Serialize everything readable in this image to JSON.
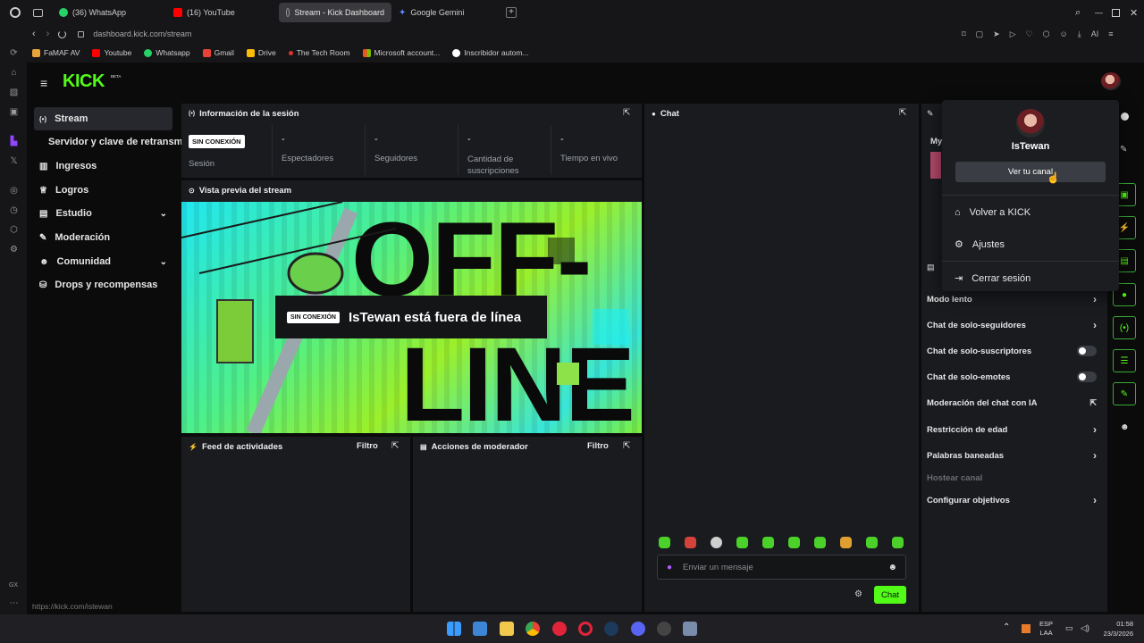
{
  "browser": {
    "tabs": [
      {
        "label": "(36) WhatsApp",
        "color": "#25d366"
      },
      {
        "label": "(16) YouTube",
        "color": "#ff0000"
      },
      {
        "label": "Stream - Kick Dashboard",
        "color": "#888888"
      },
      {
        "label": "Google Gemini",
        "color": "#5b8cff"
      }
    ],
    "url": "dashboard.kick.com/stream",
    "url_host_bold": "kick.com",
    "toolbar_ai": "AI",
    "status_url": "https://kick.com/istewan",
    "bookmarks": [
      {
        "label": "FaMAF AV",
        "color": "#e8a33a"
      },
      {
        "label": "Youtube",
        "color": "#ff0000"
      },
      {
        "label": "Whatsapp",
        "color": "#25d366"
      },
      {
        "label": "Gmail",
        "color": "#ea4335"
      },
      {
        "label": "Drive",
        "color": "#fbbc04"
      },
      {
        "label": "The Tech Room",
        "color": "#d33"
      },
      {
        "label": "Microsoft account...",
        "color": "#f25022"
      },
      {
        "label": "Inscribidor autom...",
        "color": "#ffffff"
      }
    ],
    "gx_label": "GX"
  },
  "kick": {
    "logo": "KICK",
    "logo_badge": "BETA",
    "accent": "#53fc18",
    "sidebar": [
      {
        "label": "Stream",
        "icon": "broadcast-icon",
        "active": true
      },
      {
        "label": "Servidor y clave de retransmisión",
        "icon": "",
        "active": false
      },
      {
        "label": "Ingresos",
        "icon": "chart-icon",
        "active": false
      },
      {
        "label": "Logros",
        "icon": "trophy-icon",
        "active": false
      },
      {
        "label": "Estudio",
        "icon": "studio-icon",
        "active": false,
        "expandable": true
      },
      {
        "label": "Moderación",
        "icon": "wrench-icon",
        "active": false
      },
      {
        "label": "Comunidad",
        "icon": "community-icon",
        "active": false,
        "expandable": true
      },
      {
        "label": "Drops y recompensas",
        "icon": "drops-icon",
        "active": false
      }
    ],
    "session": {
      "title": "Información de la sesión",
      "badge": "SIN CONEXIÓN",
      "stats": [
        {
          "value": "",
          "label": "Sesión"
        },
        {
          "value": "-",
          "label": "Espectadores"
        },
        {
          "value": "-",
          "label": "Seguidores"
        },
        {
          "value": "-",
          "label": "Cantidad de suscripciones"
        },
        {
          "value": "-",
          "label": "Tiempo en vivo"
        }
      ]
    },
    "preview": {
      "title": "Vista previa del stream",
      "badge": "SIN CONEXIÓN",
      "offline_text": "IsTewan está fuera de línea",
      "bg_text_1": "OFF-",
      "bg_text_2": "LINE"
    },
    "activity": {
      "title": "Feed de actividades",
      "filter": "Filtro"
    },
    "modactions": {
      "title": "Acciones de moderador",
      "filter": "Filtro"
    },
    "chat": {
      "title": "Chat",
      "placeholder": "Enviar un mensaje",
      "send": "Chat"
    },
    "right_panel": {
      "title_partial": "My"
    },
    "mod_settings": [
      {
        "label": "Modo lento",
        "control": "chevron"
      },
      {
        "label": "Chat de solo-seguidores",
        "control": "chevron"
      },
      {
        "label": "Chat de solo-suscriptores",
        "control": "toggle"
      },
      {
        "label": "Chat de solo-emotes",
        "control": "toggle"
      },
      {
        "label": "Moderación del chat con IA",
        "control": "external"
      },
      {
        "label": "Restricción de edad",
        "control": "chevron"
      },
      {
        "label": "Palabras baneadas",
        "control": "chevron"
      },
      {
        "label": "Hostear canal",
        "control": "none"
      },
      {
        "label": "Configurar objetivos",
        "control": "chevron"
      }
    ],
    "user_menu": {
      "username": "IsTewan",
      "view_channel": "Ver tu canal",
      "items": [
        {
          "label": "Volver a KICK",
          "icon": "home-icon"
        },
        {
          "label": "Ajustes",
          "icon": "gear-icon"
        },
        {
          "label": "Cerrar sesión",
          "icon": "logout-icon"
        }
      ]
    }
  },
  "taskbar": {
    "lang": "ESP",
    "lang2": "LAA",
    "time": "01:58",
    "date": "23/3/2026"
  }
}
